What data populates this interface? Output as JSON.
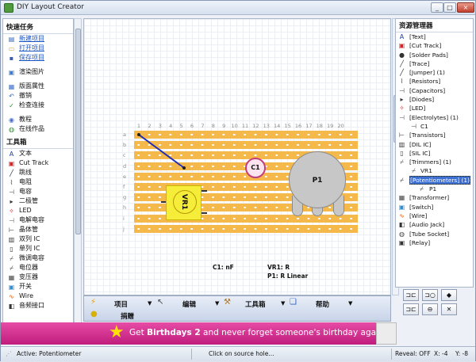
{
  "window": {
    "title": "DIY Layout Creator",
    "minimize": "_",
    "maximize": "□",
    "close": "×"
  },
  "left": {
    "quick_tasks_header": "快速任务",
    "quick_tasks": [
      {
        "label": "新建项目",
        "icon": "new-doc-icon"
      },
      {
        "label": "打开项目",
        "icon": "open-folder-icon"
      },
      {
        "label": "保存项目",
        "icon": "save-disk-icon"
      }
    ],
    "render": {
      "label": "渲染图片",
      "icon": "image-icon"
    },
    "edit_items": [
      {
        "label": "版面属性",
        "icon": "layout-icon"
      },
      {
        "label": "撤销",
        "icon": "undo-icon"
      },
      {
        "label": "检查连接",
        "icon": "check-icon"
      }
    ],
    "help_items": [
      {
        "label": "教程",
        "icon": "tutorial-icon"
      },
      {
        "label": "在线作品",
        "icon": "globe-icon"
      }
    ],
    "toolbox_header": "工具箱",
    "tools": [
      {
        "label": "文本",
        "icon": "text-A-icon"
      },
      {
        "label": "Cut Track",
        "icon": "cut-track-icon"
      },
      {
        "label": "跳线",
        "icon": "jumper-icon"
      },
      {
        "label": "电阻",
        "icon": "resistor-icon"
      },
      {
        "label": "电容",
        "icon": "capacitor-icon"
      },
      {
        "label": "二极管",
        "icon": "diode-icon"
      },
      {
        "label": "LED",
        "icon": "led-icon"
      },
      {
        "label": "电解电容",
        "icon": "electrolytic-icon"
      },
      {
        "label": "晶体管",
        "icon": "transistor-icon"
      },
      {
        "label": "双列 IC",
        "icon": "dil-ic-icon"
      },
      {
        "label": "单列 IC",
        "icon": "sil-ic-icon"
      },
      {
        "label": "微调电容",
        "icon": "trimmer-icon"
      },
      {
        "label": "电位器",
        "icon": "potentiometer-icon"
      },
      {
        "label": "变压器",
        "icon": "transformer-icon"
      },
      {
        "label": "开关",
        "icon": "switch-icon"
      },
      {
        "label": "Wire",
        "icon": "wire-icon"
      },
      {
        "label": "音频接口",
        "icon": "audio-jack-icon"
      }
    ]
  },
  "board": {
    "columns": [
      "1",
      "2",
      "3",
      "4",
      "5",
      "6",
      "7",
      "8",
      "9",
      "10",
      "11",
      "12",
      "13",
      "14",
      "15",
      "16",
      "17",
      "18",
      "19",
      "20"
    ],
    "rows": [
      "a",
      "b",
      "c",
      "d",
      "e",
      "f",
      "g",
      "h",
      "i",
      "j"
    ],
    "components": {
      "vr1": "VR1",
      "c1": "C1",
      "p1": "P1"
    },
    "labels": {
      "c1_value": "C1: nF",
      "vr1_value": "VR1: R",
      "p1_value": "P1: R Linear"
    },
    "strip_color": "#f5b84a"
  },
  "menu": {
    "project": "项目",
    "edit": "编辑",
    "toolbox": "工具箱",
    "help": "帮助",
    "donate": "捐赠"
  },
  "resource_manager": {
    "header": "资源管理器",
    "items": [
      {
        "label": "[Text]",
        "icon": "text-A-icon",
        "level": 0
      },
      {
        "label": "[Cut Track]",
        "icon": "cut-track-icon",
        "level": 0
      },
      {
        "label": "[Solder Pads]",
        "icon": "solder-pad-icon",
        "level": 0
      },
      {
        "label": "[Trace]",
        "icon": "trace-icon",
        "level": 0
      },
      {
        "label": "[Jumper] (1)",
        "icon": "jumper-icon",
        "level": 0
      },
      {
        "label": "[Resistors]",
        "icon": "resistor-icon",
        "level": 0
      },
      {
        "label": "[Capacitors]",
        "icon": "capacitor-icon",
        "level": 0
      },
      {
        "label": "[Diodes]",
        "icon": "diode-icon",
        "level": 0
      },
      {
        "label": "[LED]",
        "icon": "led-icon",
        "level": 0
      },
      {
        "label": "[Electrolytes] (1)",
        "icon": "electrolytic-icon",
        "level": 0
      },
      {
        "label": "C1",
        "icon": "capacitor-icon",
        "level": 1
      },
      {
        "label": "[Transistors]",
        "icon": "transistor-icon",
        "level": 0
      },
      {
        "label": "[DIL IC]",
        "icon": "dil-ic-icon",
        "level": 0
      },
      {
        "label": "[SIL IC]",
        "icon": "sil-ic-icon",
        "level": 0
      },
      {
        "label": "[Trimmers] (1)",
        "icon": "trimmer-icon",
        "level": 0
      },
      {
        "label": "VR1",
        "icon": "trimmer-icon",
        "level": 1
      },
      {
        "label": "[Potentiometers] (1)",
        "icon": "potentiometer-icon",
        "level": 0,
        "selected": true
      },
      {
        "label": "P1",
        "icon": "potentiometer-icon",
        "level": 2
      },
      {
        "label": "[Transformer]",
        "icon": "transformer-icon",
        "level": 0
      },
      {
        "label": "[Switch]",
        "icon": "switch-icon",
        "level": 0
      },
      {
        "label": "[Wire]",
        "icon": "wire-icon",
        "level": 0
      },
      {
        "label": "[Audio Jack]",
        "icon": "audio-jack-icon",
        "level": 0
      },
      {
        "label": "[Tube Socket]",
        "icon": "tube-socket-icon",
        "level": 0
      },
      {
        "label": "[Relay]",
        "icon": "relay-icon",
        "level": 0
      }
    ]
  },
  "right_buttons": [
    "⊐⊏",
    "⊐○",
    "◆",
    "⊐⊏",
    "⊖",
    "✕"
  ],
  "banner": {
    "prefix": "Get ",
    "bold": "Birthdays 2",
    "suffix": " and never forget someone's birthday agai"
  },
  "status": {
    "active": "Active: Potentiometer",
    "hint": "Click on source hole...",
    "reveal": "Reveal: OFF",
    "x": "X: -4",
    "y": "Y: -8"
  }
}
